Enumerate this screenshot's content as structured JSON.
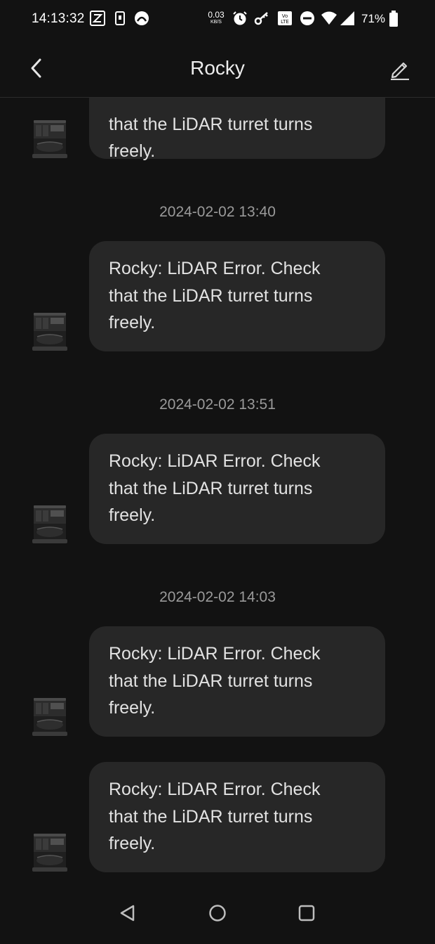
{
  "status_bar": {
    "time": "14:13:32",
    "speed_value": "0.03",
    "speed_unit": "KB/S",
    "battery": "71%"
  },
  "header": {
    "title": "Rocky",
    "back_icon": "chevron-left-icon",
    "edit_icon": "pencil-icon"
  },
  "messages": [
    {
      "timestamp": "",
      "lines": [
        "that the LiDAR turret turns",
        "freely."
      ],
      "partial": true
    },
    {
      "timestamp": "2024-02-02 13:40",
      "lines": [
        "Rocky: LiDAR Error. Check",
        "that the LiDAR turret turns",
        "freely."
      ]
    },
    {
      "timestamp": "2024-02-02 13:51",
      "lines": [
        "Rocky: LiDAR Error. Check",
        "that the LiDAR turret turns",
        "freely."
      ]
    },
    {
      "timestamp": "2024-02-02 14:03",
      "lines": [
        "Rocky: LiDAR Error. Check",
        "that the LiDAR turret turns",
        "freely."
      ]
    },
    {
      "timestamp": "",
      "lines": [
        "Rocky: LiDAR Error. Check",
        "that the LiDAR turret turns",
        "freely."
      ]
    }
  ],
  "nav": {
    "back_icon": "triangle-back-icon",
    "home_icon": "circle-home-icon",
    "recents_icon": "square-recents-icon"
  },
  "colors": {
    "background": "#121212",
    "bubble": "#272727",
    "text": "#e2e2e2",
    "timestamp": "#9a9a9a"
  }
}
